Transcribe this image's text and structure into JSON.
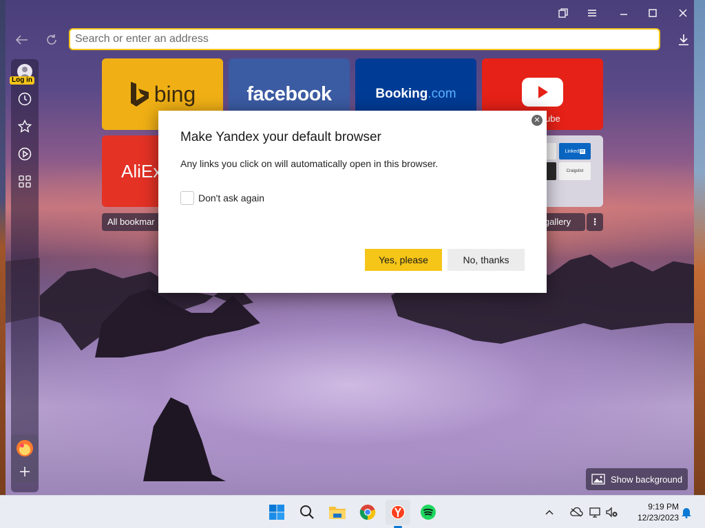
{
  "window": {
    "controls": {
      "collections": "collections-icon",
      "menu": "menu-icon",
      "minimize": "minimize-icon",
      "maximize": "maximize-icon",
      "close": "close-icon"
    }
  },
  "toolbar": {
    "address_placeholder": "Search or enter an address",
    "address_value": ""
  },
  "sidebar": {
    "login_label": "Log in"
  },
  "tiles": [
    {
      "name": "bing",
      "label": "bing",
      "color": "#f0b015"
    },
    {
      "name": "facebook",
      "label": "facebook",
      "color": "#3b5ba3"
    },
    {
      "name": "booking",
      "label": "Booking",
      "label_suffix": ".com",
      "color": "#003b95"
    },
    {
      "name": "youtube",
      "label": "ube",
      "color": "#e62117"
    },
    {
      "name": "aliexpress",
      "label": "AliEx",
      "color": "#e43225"
    },
    {
      "name": "gallery",
      "label_linkedin": "Linked",
      "label_linkedin_in": "in",
      "label_craigslist": "Craigslist",
      "color": "#d9d5e0"
    }
  ],
  "tile_labels": {
    "all_bookmarks": "All bookmar",
    "gallery": "d gallery",
    "more": "⋮"
  },
  "dialog": {
    "title": "Make Yandex your default browser",
    "text": "Any links you click on will automatically open in this browser.",
    "checkbox_label": "Don't ask again",
    "checkbox_checked": false,
    "yes_label": "Yes, please",
    "no_label": "No, thanks",
    "close_glyph": "✕"
  },
  "show_background_label": "Show background",
  "taskbar": {
    "time": "9:19 PM",
    "date": "12/23/2023"
  },
  "colors": {
    "accent": "#f5c518",
    "dialog_bg": "#ffffff",
    "taskbar_bg": "#e9ecf2"
  }
}
